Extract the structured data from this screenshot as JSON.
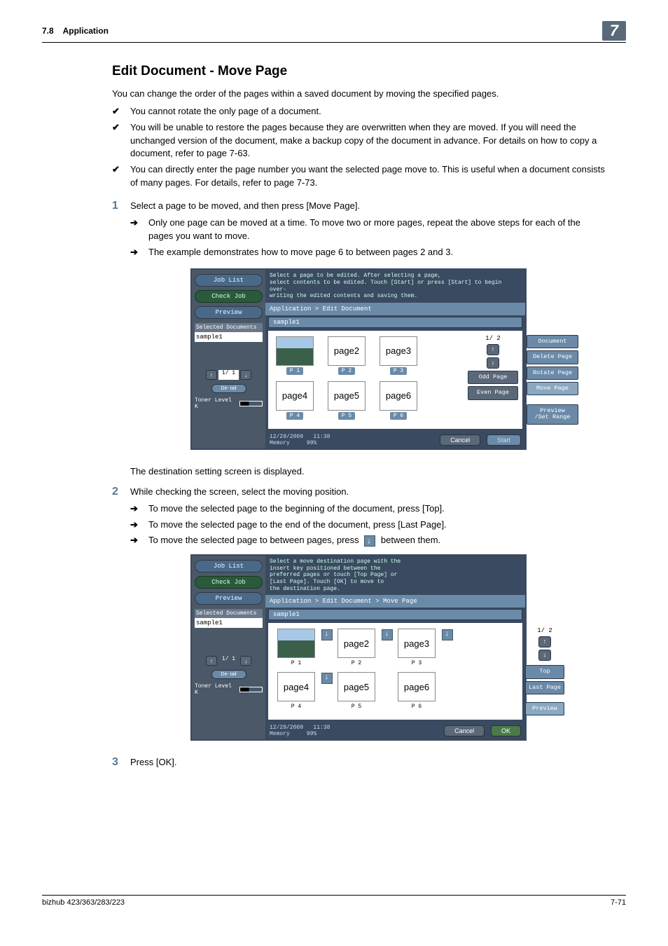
{
  "header": {
    "section_number": "7.8",
    "section_title": "Application",
    "chapter_badge": "7"
  },
  "heading": "Edit Document - Move Page",
  "intro": "You can change the order of the pages within a saved document by moving the specified pages.",
  "bullets": [
    "You cannot rotate the only page of a document.",
    "You will be unable to restore the pages because they are overwritten when they are moved. If you will need the unchanged version of the document, make a backup copy of the document in advance. For details on how to copy a document, refer to page 7-63.",
    "You can directly enter the page number you want the selected page move to. This is useful when a document consists of many pages. For details, refer to page 7-73."
  ],
  "steps": {
    "s1": {
      "n": "1",
      "text": "Select a page to be moved, and then press [Move Page]."
    },
    "s1_subs": [
      "Only one page can be moved at a time. To move two or more pages, repeat the above steps for each of the pages you want to move.",
      "The example demonstrates how to move page 6 to between pages 2 and 3."
    ],
    "dest_line": "The destination setting screen is displayed.",
    "s2": {
      "n": "2",
      "text": "While checking the screen, select the moving position."
    },
    "s2_subs_a": "To move the selected page to the beginning of the document, press [Top].",
    "s2_subs_b": "To move the selected page to the end of the document, press [Last Page].",
    "s2_subs_c_pre": "To move the selected page to between pages, press",
    "s2_subs_c_post": "between them.",
    "s3": {
      "n": "3",
      "text": "Press [OK]."
    }
  },
  "screen1": {
    "left_buttons": {
      "job_list": "Job List",
      "check_job": "Check Job",
      "preview": "Preview"
    },
    "selected_docs_label": "Selected Documents",
    "doc_name": "sample1",
    "pager_text": "1/  1",
    "details": "De-\ntail",
    "toner": "Toner Level  K",
    "msg": "Select a page to be edited. After selecting a page,\nselect contents to be edited. Touch [Start] or press [Start] to begin over-\nwriting the edited contents and saving them.",
    "breadcrumb": "Application > Edit Document",
    "docbar": "sample1",
    "pages": [
      "page2",
      "page3",
      "page4",
      "page5",
      "page6"
    ],
    "plabels": [
      "P   1",
      "P   2",
      "P   3",
      "P   4",
      "P   5",
      "P   6"
    ],
    "side": {
      "page_count": "1/  2",
      "document": "Document",
      "delete": "Delete Page",
      "rotate": "Rotate Page",
      "move": "Move Page",
      "odd": "Odd Page",
      "even": "Even Page",
      "preview": "Preview\n/Set Range"
    },
    "footer": {
      "date": "12/29/2009",
      "time": "11:38",
      "mem": "Memory",
      "pct": "99%",
      "cancel": "Cancel",
      "start": "Start"
    }
  },
  "screen2": {
    "left_buttons": {
      "job_list": "Job List",
      "check_job": "Check Job",
      "preview": "Preview"
    },
    "selected_docs_label": "Selected Documents",
    "doc_name": "sample1",
    "pager_text": "1/  1",
    "details": "De-\ntail",
    "toner": "Toner Level  K",
    "msg": "Select a move destination page with the\ninsert key positioned between the\npreferred pages or touch [Top Page] or\n[Last Page]. Touch [OK] to move to\nthe destination page.",
    "breadcrumb": "Application > Edit Document > Move Page",
    "docbar": "sample1",
    "pages": [
      "page2",
      "page3",
      "page4",
      "page5",
      "page6"
    ],
    "plabels": [
      "P   1",
      "P   2",
      "P   3",
      "P   4",
      "P   5",
      "P   6"
    ],
    "side": {
      "page_count": "1/  2",
      "top": "Top",
      "last": "Last Page",
      "preview": "Preview"
    },
    "footer": {
      "date": "12/29/2009",
      "time": "11:38",
      "mem": "Memory",
      "pct": "99%",
      "cancel": "Cancel",
      "ok": "OK"
    }
  },
  "footer": {
    "model": "bizhub 423/363/283/223",
    "page": "7-71"
  }
}
